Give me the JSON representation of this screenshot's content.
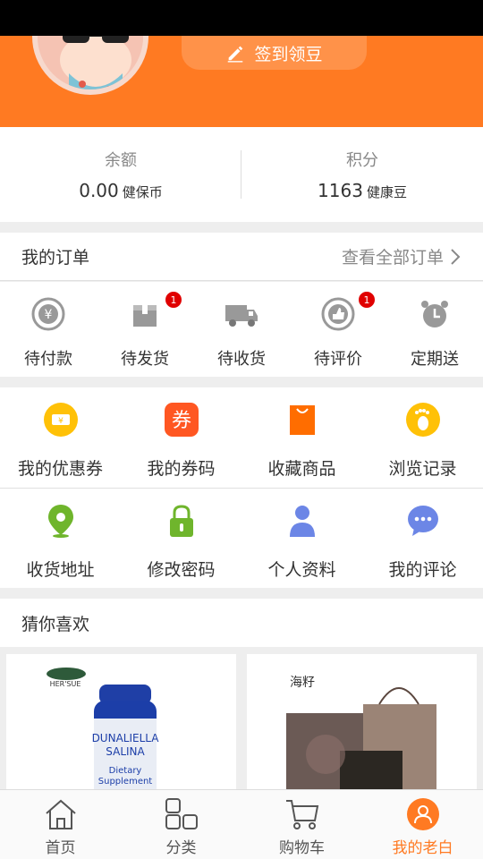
{
  "header": {
    "checkin_label": "签到领豆"
  },
  "balance": {
    "left": {
      "label": "余额",
      "value": "0.00",
      "unit": "健保币"
    },
    "right": {
      "label": "积分",
      "value": "1163",
      "unit": "健康豆"
    }
  },
  "orders": {
    "title": "我的订单",
    "view_all": "查看全部订单",
    "items": [
      {
        "label": "待付款",
        "icon": "yen-coin-icon",
        "badge": null
      },
      {
        "label": "待发货",
        "icon": "package-box-icon",
        "badge": "1"
      },
      {
        "label": "待收货",
        "icon": "truck-icon",
        "badge": null
      },
      {
        "label": "待评价",
        "icon": "thumbs-up-icon",
        "badge": "1"
      },
      {
        "label": "定期送",
        "icon": "alarm-clock-icon",
        "badge": null
      }
    ]
  },
  "services": {
    "row1": [
      {
        "label": "我的优惠券",
        "icon": "ticket-icon",
        "color": "#ffc107"
      },
      {
        "label": "我的券码",
        "icon": "coupon-code-icon",
        "color": "#ff5722"
      },
      {
        "label": "收藏商品",
        "icon": "shopping-bag-icon",
        "color": "#ff6d00"
      },
      {
        "label": "浏览记录",
        "icon": "footprint-icon",
        "color": "#ffc107"
      }
    ],
    "row2": [
      {
        "label": "收货地址",
        "icon": "location-pin-icon",
        "color": "#6fb52c"
      },
      {
        "label": "修改密码",
        "icon": "padlock-icon",
        "color": "#6fb52c"
      },
      {
        "label": "个人资料",
        "icon": "person-icon",
        "color": "#6c86e6"
      },
      {
        "label": "我的评论",
        "icon": "chat-bubble-icon",
        "color": "#6c86e6"
      }
    ],
    "coupon_glyph": "券"
  },
  "recommend": {
    "title": "猜你喜欢",
    "products": [
      {
        "brand": "HER'SUE",
        "text_lines": [
          "DUNALIELLA",
          "SALINA",
          "Dietary",
          "Supplement"
        ]
      },
      {
        "brand": "海籽"
      }
    ]
  },
  "tabbar": {
    "items": [
      {
        "label": "首页",
        "icon": "home-icon"
      },
      {
        "label": "分类",
        "icon": "category-grid-icon"
      },
      {
        "label": "购物车",
        "icon": "cart-icon"
      },
      {
        "label": "我的老白",
        "icon": "profile-icon",
        "active": true
      }
    ]
  },
  "colors": {
    "accent": "#ff7a22",
    "badge": "#e00000"
  }
}
